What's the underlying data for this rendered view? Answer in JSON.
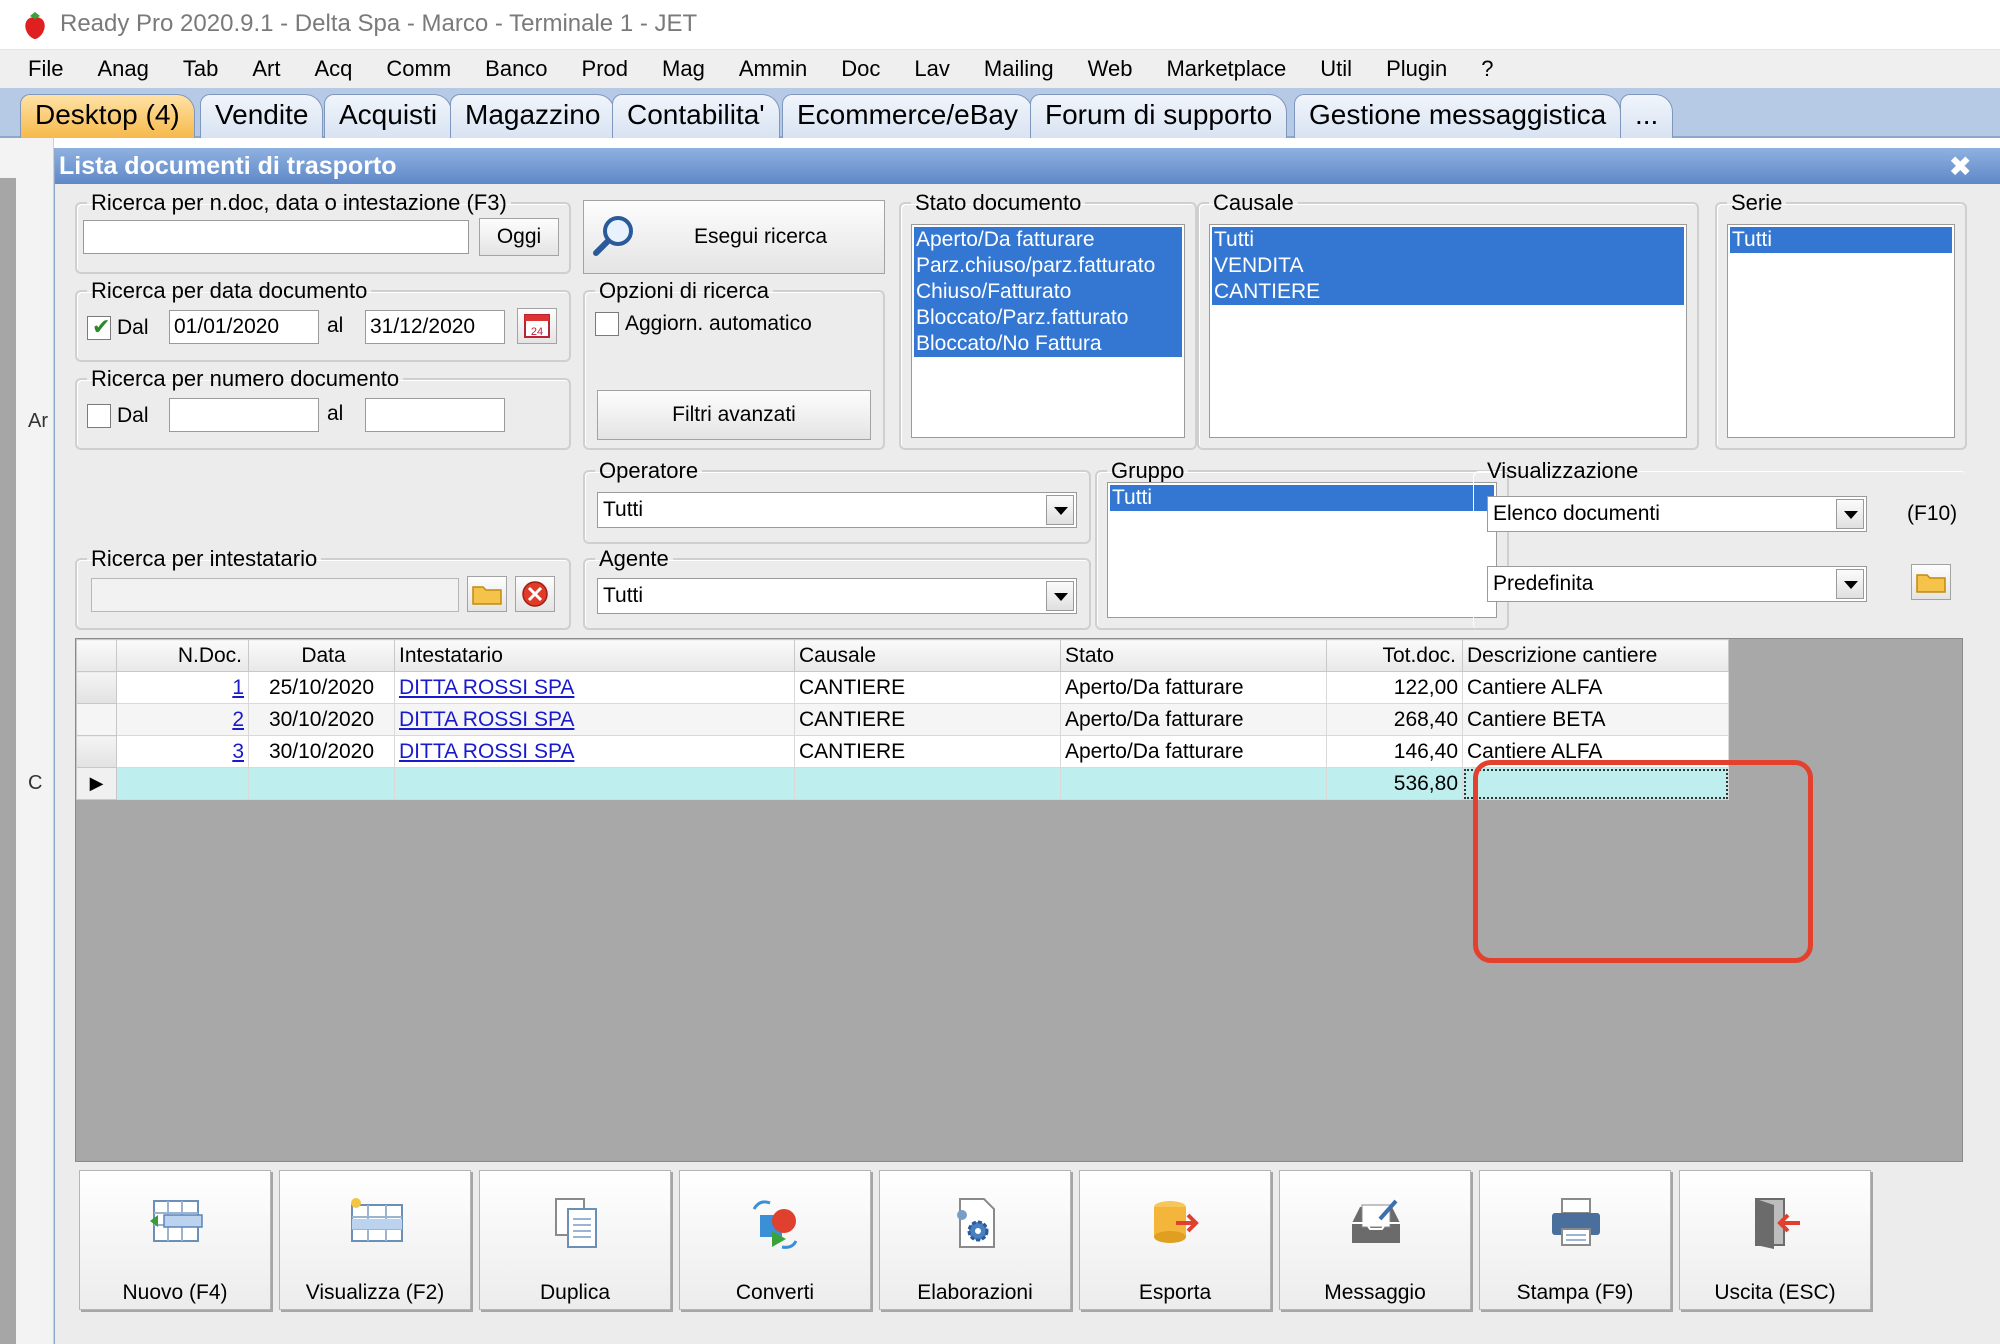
{
  "window": {
    "os_title": "Ready Pro 2020.9.1 - Delta Spa - Marco - Terminale 1 - JET"
  },
  "menu": [
    "File",
    "Anag",
    "Tab",
    "Art",
    "Acq",
    "Comm",
    "Banco",
    "Prod",
    "Mag",
    "Ammin",
    "Doc",
    "Lav",
    "Mailing",
    "Web",
    "Marketplace",
    "Util",
    "Plugin",
    "?"
  ],
  "tabs": [
    "Desktop (4)",
    "Vendite",
    "Acquisti",
    "Magazzino",
    "Contabilita'",
    "Ecommerce/eBay",
    "Forum di supporto",
    "Gestione messaggistica",
    "..."
  ],
  "desktop_behind": {
    "label_1": "Ar",
    "label_2": "C"
  },
  "dialog": {
    "title": "Lista documenti di trasporto",
    "close_symbol": "✖",
    "search_quick": {
      "legend": "Ricerca per n.doc, data o intestazione (F3)",
      "value": "",
      "today_button": "Oggi"
    },
    "search_button": "Esegui ricerca",
    "search_by_date": {
      "legend": "Ricerca per data documento",
      "from_label": "Dal",
      "from_checked": true,
      "from_value": "01/01/2020",
      "to_label": "al",
      "to_value": "31/12/2020",
      "calendar_day": "24"
    },
    "search_by_number": {
      "legend": "Ricerca per numero documento",
      "from_label": "Dal",
      "from_checked": false,
      "from_value": "",
      "to_label": "al",
      "to_value": ""
    },
    "search_options": {
      "legend": "Opzioni di ricerca",
      "auto_update_label": "Aggiorn. automatico",
      "auto_update_checked": false,
      "advanced_filters": "Filtri avanzati"
    },
    "document_state": {
      "legend": "Stato documento",
      "options": [
        "Aperto/Da fatturare",
        "Parz.chiuso/parz.fatturato",
        "Chiuso/Fatturato",
        "Bloccato/Parz.fatturato",
        "Bloccato/No Fattura"
      ]
    },
    "causale": {
      "legend": "Causale",
      "options": [
        "Tutti",
        "VENDITA",
        "CANTIERE"
      ]
    },
    "serie": {
      "legend": "Serie",
      "options": [
        "Tutti"
      ]
    },
    "operatore": {
      "legend": "Operatore",
      "value": "Tutti"
    },
    "agente": {
      "legend": "Agente",
      "value": "Tutti"
    },
    "gruppo": {
      "legend": "Gruppo",
      "options": [
        "Tutti"
      ]
    },
    "visualizzazione": {
      "legend": "Visualizzazione",
      "mode": "Elenco documenti",
      "shortcut": "(F10)",
      "layout": "Predefinita"
    },
    "search_holder": {
      "legend": "Ricerca per intestatario",
      "value": ""
    }
  },
  "grid": {
    "columns": [
      "N.Doc.",
      "Data",
      "Intestatario",
      "Causale",
      "Stato",
      "Tot.doc.",
      "Descrizione cantiere"
    ],
    "rows": [
      {
        "ndoc": "1",
        "data": "25/10/2020",
        "intestatario": "DITTA ROSSI SPA",
        "causale": "CANTIERE",
        "stato": "Aperto/Da fatturare",
        "tot": "122,00",
        "descrizione": "Cantiere ALFA"
      },
      {
        "ndoc": "2",
        "data": "30/10/2020",
        "intestatario": "DITTA ROSSI SPA",
        "causale": "CANTIERE",
        "stato": "Aperto/Da fatturare",
        "tot": "268,40",
        "descrizione": "Cantiere BETA"
      },
      {
        "ndoc": "3",
        "data": "30/10/2020",
        "intestatario": "DITTA ROSSI SPA",
        "causale": "CANTIERE",
        "stato": "Aperto/Da fatturare",
        "tot": "146,40",
        "descrizione": "Cantiere ALFA"
      }
    ],
    "total_row": {
      "indicator": "▶",
      "tot": "536,80",
      "descrizione": ""
    }
  },
  "toolbar": [
    {
      "label": "Nuovo (F4)",
      "icon": "new-document-icon"
    },
    {
      "label": "Visualizza (F2)",
      "icon": "view-table-icon"
    },
    {
      "label": "Duplica",
      "icon": "duplicate-icon"
    },
    {
      "label": "Converti",
      "icon": "convert-icon"
    },
    {
      "label": "Elaborazioni",
      "icon": "process-gear-icon"
    },
    {
      "label": "Esporta",
      "icon": "export-database-icon"
    },
    {
      "label": "Messaggio",
      "icon": "message-inbox-icon"
    },
    {
      "label": "Stampa (F9)",
      "icon": "printer-icon"
    },
    {
      "label": "Uscita (ESC)",
      "icon": "exit-door-icon"
    }
  ],
  "colors": {
    "selection": "#3477d3",
    "active_tab": "#f6b94b",
    "highlight_box": "#e3412d",
    "total_row": "#bfeeee",
    "link": "#1a1acc"
  }
}
